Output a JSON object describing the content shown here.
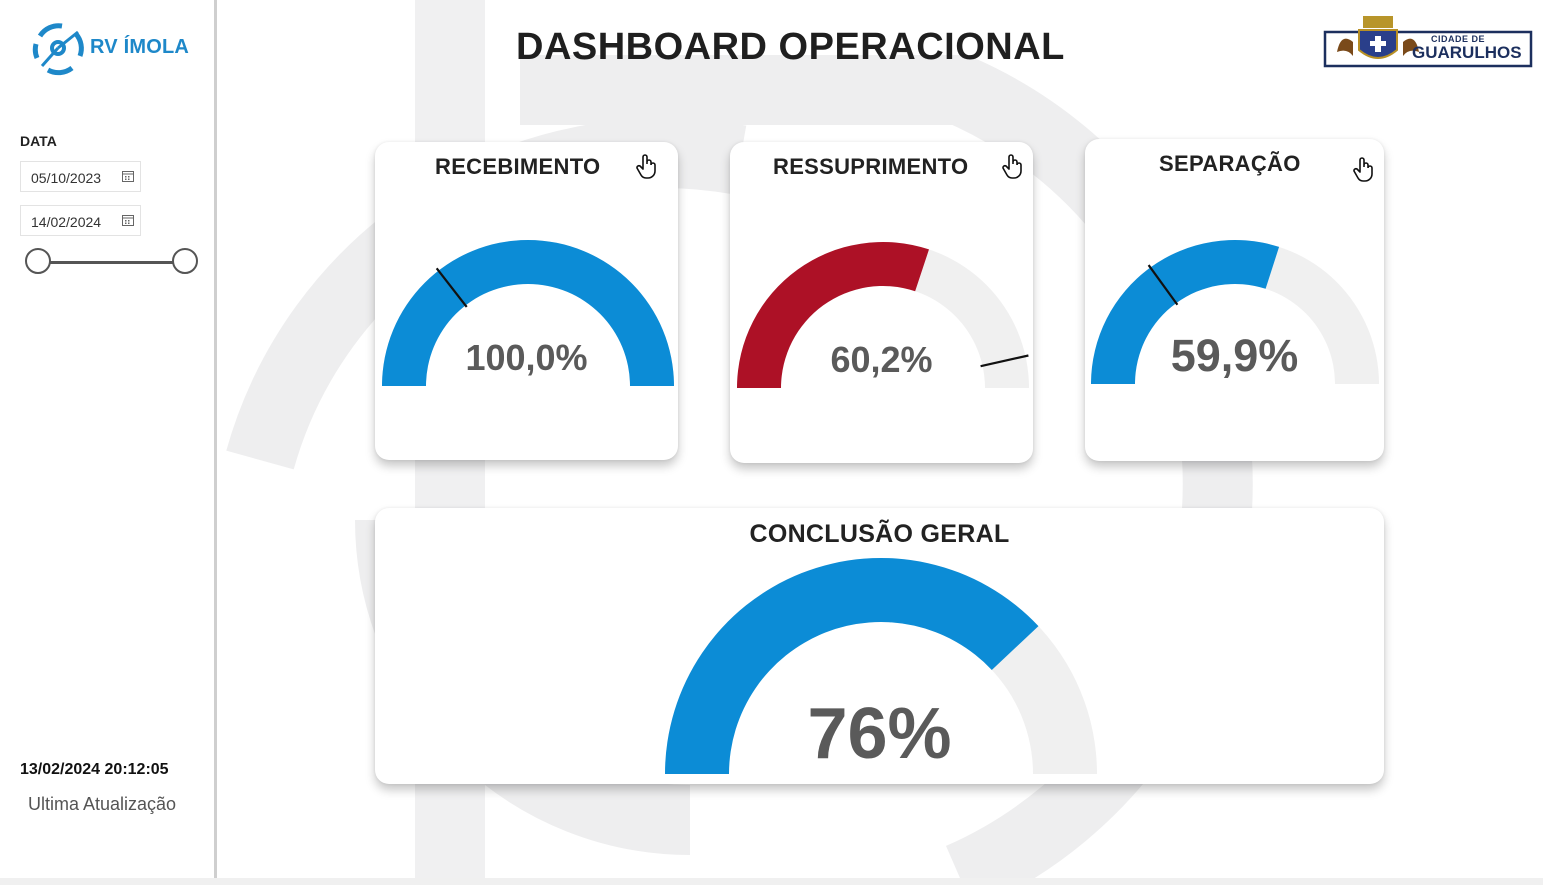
{
  "header": {
    "title": "DASHBOARD OPERACIONAL",
    "brand_logo_text": "RV ÍMOLA",
    "city_logo_text_line1": "CIDADE DE",
    "city_logo_text_line2": "GUARULHOS"
  },
  "sidebar": {
    "date_label": "DATA",
    "start_date": "05/10/2023",
    "end_date": "14/02/2024",
    "last_update_time": "13/02/2024 20:12:05",
    "last_update_label": "Ultima Atualização"
  },
  "cards": {
    "recebimento": {
      "title": "RECEBIMENTO",
      "value_label": "100,0%",
      "fill_fraction": 1.0,
      "target_fraction": 0.29,
      "fill_color": "#0c8cd6"
    },
    "ressuprimento": {
      "title": "RESSUPRIMENTO",
      "value_label": "60,2%",
      "fill_fraction": 0.602,
      "target_fraction": 0.93,
      "fill_color": "#ad1126"
    },
    "separacao": {
      "title": "SEPARAÇÃO",
      "value_label": "59,9%",
      "fill_fraction": 0.599,
      "target_fraction": 0.3,
      "fill_color": "#0c8cd6"
    },
    "conclusao": {
      "title": "CONCLUSÃO GERAL",
      "value_label": "76%",
      "fill_fraction": 0.76,
      "fill_color": "#0c8cd6"
    }
  },
  "colors": {
    "accent_blue": "#0c8cd6",
    "accent_red": "#ad1126",
    "gauge_track": "#f0f0f0",
    "value_text": "#5a5a5a"
  },
  "icons": [
    "hand-pointer-icon",
    "calendar-icon"
  ]
}
